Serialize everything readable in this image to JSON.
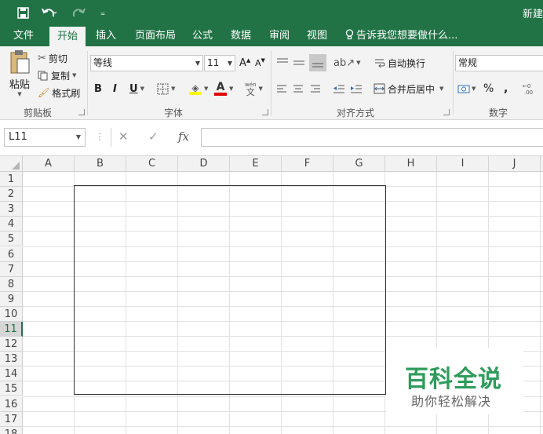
{
  "titlebar": {
    "doc_title": "新建",
    "customize_glyph": "₌"
  },
  "tabs": [
    "文件",
    "开始",
    "插入",
    "页面布局",
    "公式",
    "数据",
    "审阅",
    "视图"
  ],
  "active_tab": "开始",
  "tell_me": "告诉我您想要做什么...",
  "ribbon": {
    "clipboard": {
      "paste": "粘贴",
      "cut": "剪切",
      "copy": "复制",
      "format_painter": "格式刷",
      "label": "剪贴板"
    },
    "font": {
      "font_name": "等线",
      "font_size": "11",
      "grow": "A",
      "shrink": "A",
      "bold": "B",
      "italic": "I",
      "underline": "U",
      "font_color_glyph": "A",
      "phonetic": "wén",
      "label": "字体"
    },
    "alignment": {
      "wrap_text": "自动换行",
      "merge_center": "合并后居中",
      "label": "对齐方式"
    },
    "number": {
      "format": "常规",
      "percent": "%",
      "comma": ",",
      "label": "数字"
    }
  },
  "formula_bar": {
    "name_box": "L11",
    "fx": "fx",
    "formula": ""
  },
  "sheet": {
    "columns": [
      "A",
      "B",
      "C",
      "D",
      "E",
      "F",
      "G",
      "H",
      "I",
      "J"
    ],
    "rows": [
      "1",
      "2",
      "3",
      "4",
      "5",
      "6",
      "7",
      "8",
      "9",
      "10",
      "11",
      "12",
      "13",
      "14",
      "15",
      "16",
      "17",
      "18"
    ],
    "active_row": "11",
    "active_cell": "L11"
  },
  "watermark": {
    "title": "百科全说",
    "subtitle": "助你轻松解决"
  },
  "colors": {
    "accent": "#217346",
    "watermark_green": "#2e9c5b"
  }
}
